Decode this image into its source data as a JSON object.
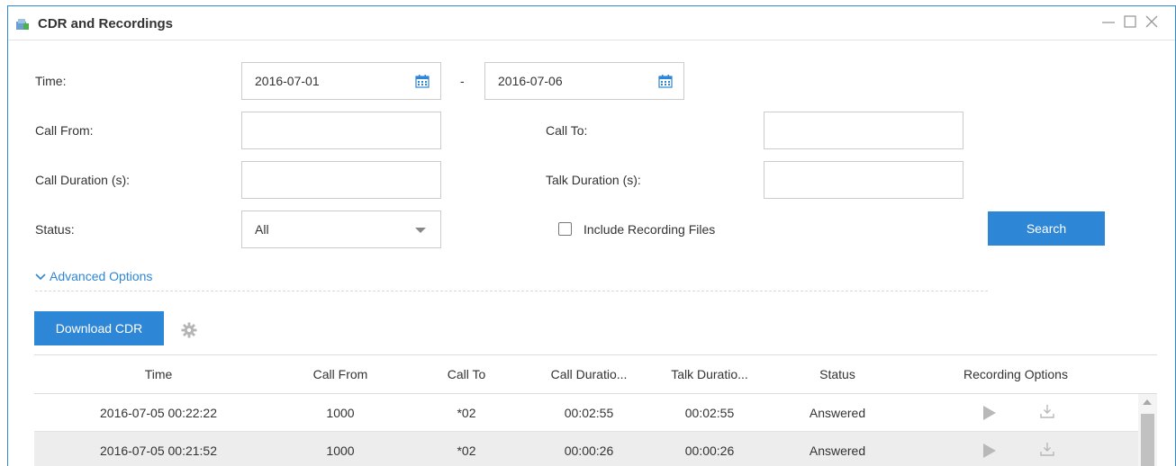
{
  "window": {
    "title": "CDR and Recordings",
    "icons": {
      "app": "cdr-app-icon",
      "minimize": "minimize-icon",
      "maximize": "maximize-icon",
      "close": "close-icon"
    }
  },
  "filters": {
    "time_label": "Time:",
    "time_from": "2016-07-01",
    "time_separator": "-",
    "time_to": "2016-07-06",
    "call_from_label": "Call From:",
    "call_from_value": "",
    "call_to_label": "Call To:",
    "call_to_value": "",
    "call_duration_label": "Call Duration (s):",
    "call_duration_value": "",
    "talk_duration_label": "Talk Duration (s):",
    "talk_duration_value": "",
    "status_label": "Status:",
    "status_value": "All",
    "include_recording_label": "Include Recording Files",
    "include_recording_checked": false,
    "search_label": "Search",
    "advanced_options_label": "Advanced Options"
  },
  "toolbar": {
    "download_cdr_label": "Download CDR"
  },
  "table": {
    "headers": {
      "time": "Time",
      "call_from": "Call From",
      "call_to": "Call To",
      "call_duration": "Call Duratio...",
      "talk_duration": "Talk Duratio...",
      "status": "Status",
      "recording_options": "Recording Options"
    },
    "rows": [
      {
        "time": "2016-07-05 00:22:22",
        "call_from": "1000",
        "call_to": "*02",
        "call_duration": "00:02:55",
        "talk_duration": "00:02:55",
        "status": "Answered"
      },
      {
        "time": "2016-07-05 00:21:52",
        "call_from": "1000",
        "call_to": "*02",
        "call_duration": "00:00:26",
        "talk_duration": "00:00:26",
        "status": "Answered"
      }
    ]
  },
  "colors": {
    "accent": "#2e86d6",
    "window_border": "#2b8ad8",
    "alt_row": "#ededed"
  }
}
